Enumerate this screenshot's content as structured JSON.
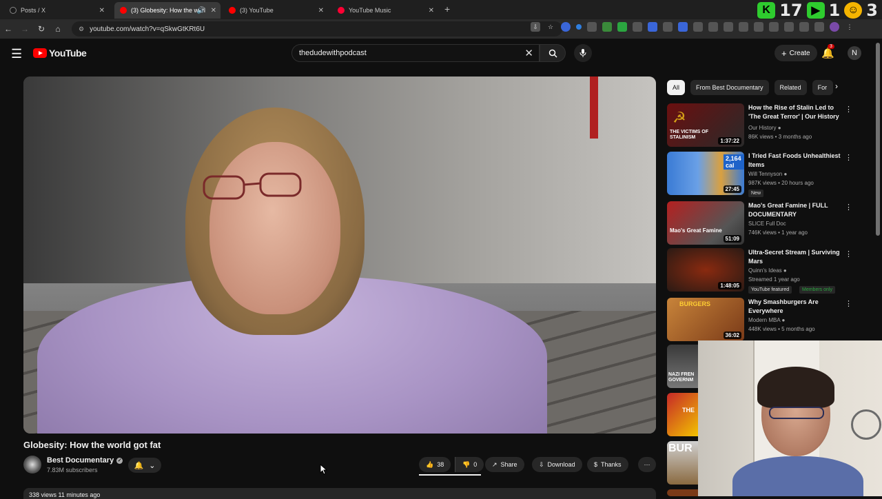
{
  "browser": {
    "tabs": [
      {
        "label": "Posts / X",
        "active": false,
        "fav_color": "#1a1a1a"
      },
      {
        "label": "(3) Globesity: How the worl",
        "active": true,
        "fav_color": "#ff0000"
      },
      {
        "label": "(3) YouTube",
        "active": false,
        "fav_color": "#ff0000"
      },
      {
        "label": "YouTube Music",
        "active": false,
        "fav_color": "#ff0033"
      }
    ],
    "url": "youtube.com/watch?v=qSkwGtKRt6U",
    "tray": {
      "k_label": "K",
      "count1": "17",
      "count2": "1",
      "count3": "3"
    }
  },
  "yt": {
    "logo": "YouTube",
    "search_query": "thedudewithpodcast",
    "create_label": "Create",
    "notif_count": "3",
    "account_initial": "N"
  },
  "video": {
    "title": "Globesity: How the world got fat",
    "channel": "Best Documentary",
    "subscribers": "7.83M subscribers",
    "likes": "38",
    "dislikes": "0",
    "share_label": "Share",
    "download_label": "Download",
    "thanks_label": "Thanks",
    "views_line": "338 views  11 minutes ago"
  },
  "sidebar": {
    "chips": [
      "All",
      "From Best Documentary",
      "Related",
      "For"
    ],
    "recommendations": [
      {
        "title": "How the Rise of Stalin Led to 'The Great Terror' | Our History",
        "channel": "Our History",
        "verified": true,
        "meta": "86K views • 3 months ago",
        "duration": "1:37:22",
        "thumb_text": "THE VICTIMS OF STALINISM",
        "colors": [
          "#6b0f0f",
          "#2a2a2a"
        ]
      },
      {
        "title": "I Tried Fast Foods Unhealthiest Items",
        "channel": "Will Tennyson",
        "verified": true,
        "meta": "987K views • 20 hours ago",
        "duration": "27:45",
        "badge": "New",
        "thumb_text": "2,164 cal",
        "colors": [
          "#3a7bd5",
          "#d9a040"
        ]
      },
      {
        "title": "Mao's Great Famine | FULL DOCUMENTARY",
        "channel": "SLICE Full Doc",
        "verified": false,
        "meta": "746K views • 1 year ago",
        "duration": "51:09",
        "thumb_text": "Mao's Great Famine",
        "colors": [
          "#b52020",
          "#555555"
        ]
      },
      {
        "title": "Ultra-Secret Stream | Surviving Mars",
        "channel": "Quinn's Ideas",
        "verified": true,
        "meta": "Streamed 1 year ago",
        "duration": "1:48:05",
        "badge": "YouTube featured",
        "badge2": "Members only",
        "thumb_text": "",
        "colors": [
          "#8a2a10",
          "#2a1a14"
        ]
      },
      {
        "title": "Why Smashburgers Are Everywhere",
        "channel": "Modern MBA",
        "verified": true,
        "meta": "448K views • 5 months ago",
        "duration": "36:02",
        "thumb_text": "BURGERS",
        "colors": [
          "#c8843a",
          "#7a3a18"
        ]
      }
    ],
    "partial_thumbs": [
      {
        "text": "NAZI FREN GOVERNM",
        "colors": [
          "#3a3a3a",
          "#777777"
        ]
      },
      {
        "text": "THE",
        "colors": [
          "#c62828",
          "#f2c200"
        ]
      },
      {
        "text": "BUR",
        "colors": [
          "#d0d0d0",
          "#8a6a40"
        ]
      }
    ]
  }
}
